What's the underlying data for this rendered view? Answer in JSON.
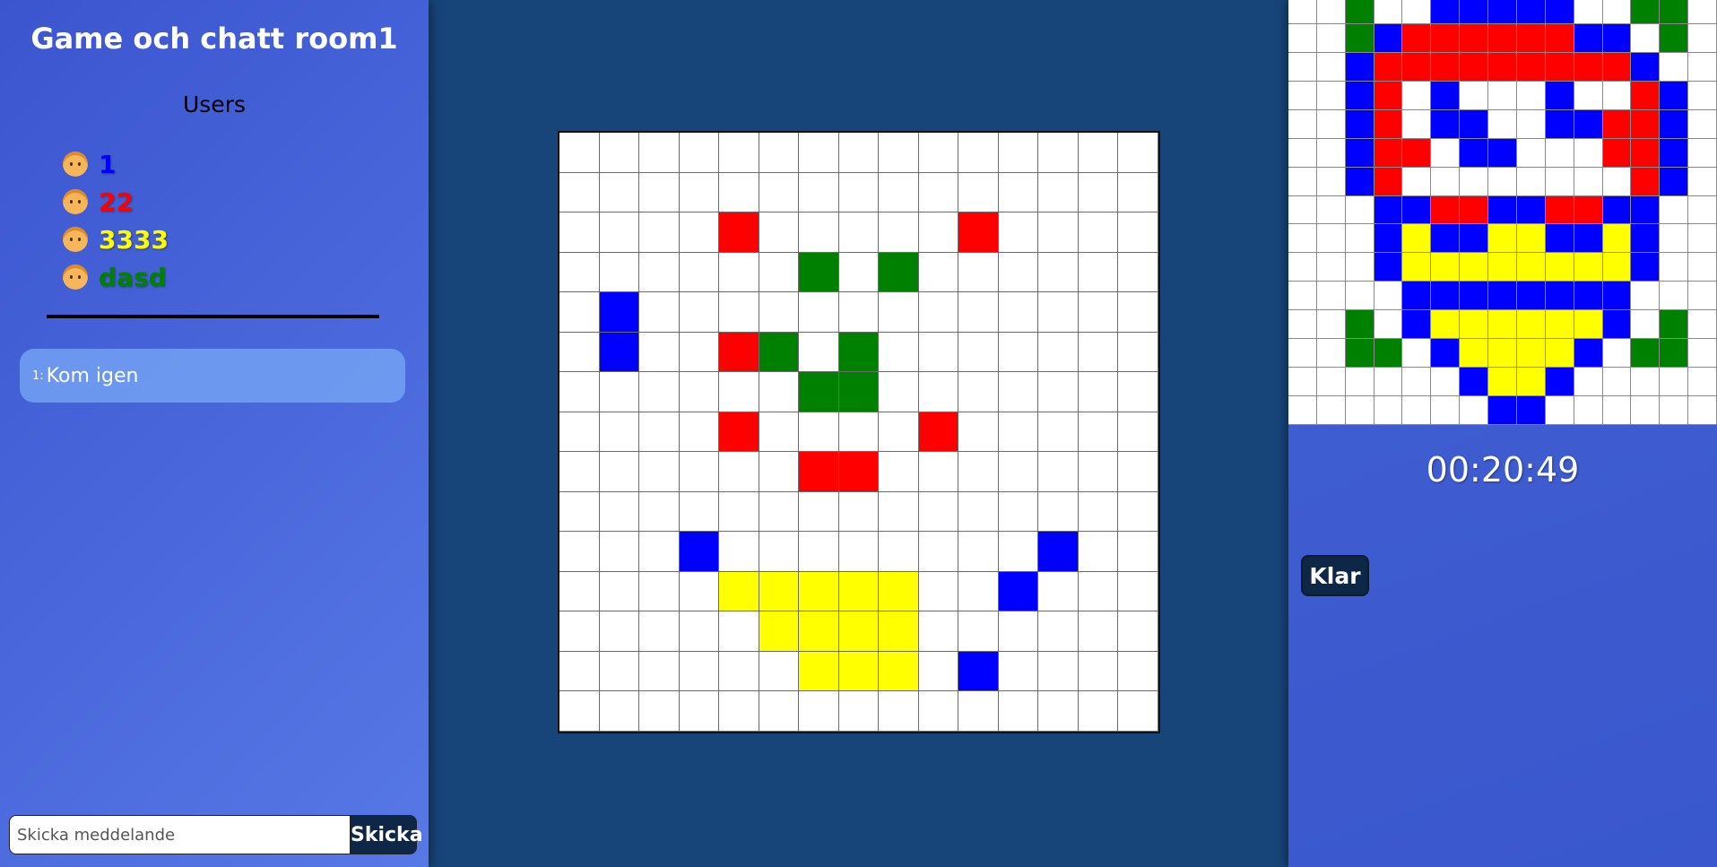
{
  "room": {
    "title": "Game och chatt room1"
  },
  "users": {
    "heading": "Users",
    "list": [
      {
        "name": "1",
        "color": "#0000ff",
        "icon": "person-face-icon"
      },
      {
        "name": "22",
        "color": "#ff0000",
        "icon": "person-face-icon"
      },
      {
        "name": "3333",
        "color": "#ffff00",
        "icon": "person-face-icon"
      },
      {
        "name": "dasd",
        "color": "#008000",
        "icon": "person-face-icon"
      }
    ]
  },
  "chat": {
    "messages": [
      {
        "sender": "1:",
        "text": "Kom igen"
      }
    ],
    "input_placeholder": "Skicka meddelande",
    "input_value": "",
    "send_label": "Skicka"
  },
  "game": {
    "palette": {
      "W": "#ffffff",
      "R": "#ff0000",
      "G": "#008000",
      "B": "#0000ff",
      "Y": "#ffff00"
    },
    "board": [
      "WWWWWWWWWWWWWWW",
      "WWWWWWWWWWWWWWW",
      "WWWWRWWWWWRWWWW",
      "WWWWWWGWGWWWWWW",
      "WBWWWWWWWWWWWWW",
      "WBWWRGWGWWWWWWW",
      "WWWWWWGGWWWWWWW",
      "WWWWRWWWWRWWWWW",
      "WWWWWWRRWWWWWWW",
      "WWWWWWWWWWWWWWW",
      "WWWBWWWWWWWWBWW",
      "WWWWYYYYYWWBWWW",
      "WWWWWYYYYWWWWWW",
      "WWWWWWYYYWBWWWW",
      "WWWWWWWWWWWWWWW"
    ],
    "target": [
      "WWGWWBBBBBWWGGW",
      "WWGBRRRRRRBBWGW",
      "WWBRRRRRRRRRBWW",
      "WWBRWBWWWBWWRBW",
      "WWBRWBBWWBBRRBW",
      "WWBRRWBBWWWRRBW",
      "WWBRWWWWWWWWRBW",
      "WWWBBRRBBRRBBWW",
      "WWWBYBBYYBBYBWW",
      "WWWBYYYYYYYYBWW",
      "WWWWBBBBBBBBWWW",
      "WWGWBYYYYYYBWGW",
      "WWGGWBYYYYBWGGW",
      "WWWWWWBYYBWWWWW",
      "WWWWWWWBBWWWWWW"
    ],
    "timer": "00:20:49",
    "done_label": "Klar"
  }
}
